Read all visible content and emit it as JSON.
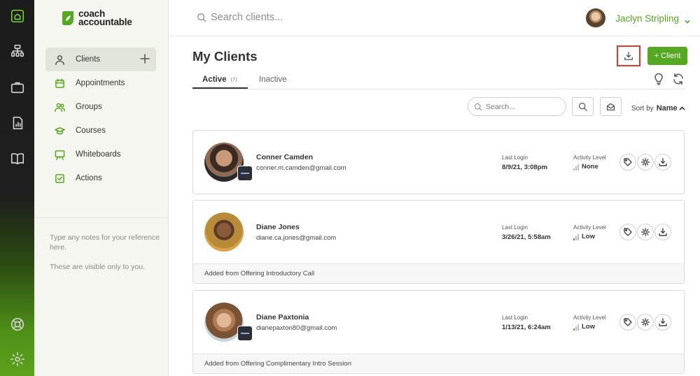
{
  "brand": {
    "line1": "coach",
    "line2": "accountable",
    "color": "#55a821"
  },
  "rail": {
    "icons": [
      "home-icon",
      "org-chart-icon",
      "briefcase-icon",
      "report-icon",
      "book-icon",
      "support-icon",
      "settings-icon"
    ]
  },
  "sidebar": {
    "items": [
      {
        "label": "Clients",
        "icon": "person-icon"
      },
      {
        "label": "Appointments",
        "icon": "calendar-icon"
      },
      {
        "label": "Groups",
        "icon": "group-icon"
      },
      {
        "label": "Courses",
        "icon": "graduation-cap-icon"
      },
      {
        "label": "Whiteboards",
        "icon": "whiteboard-icon"
      },
      {
        "label": "Actions",
        "icon": "checkbox-icon"
      }
    ],
    "notes": [
      "Type any notes for your reference here.",
      "These are visible only to you."
    ]
  },
  "topbar": {
    "search_placeholder": "Search clients...",
    "user_name": "Jaclyn Stripling"
  },
  "main": {
    "title": "My Clients",
    "add_client_label": "+ Client",
    "tabs": [
      {
        "label": "Active",
        "count": "(7)"
      },
      {
        "label": "Inactive"
      }
    ],
    "list_search_placeholder": "Search...",
    "sort_label": "Sort by",
    "sort_value": "Name"
  },
  "clients": [
    {
      "name": "Conner Camden",
      "email": "conner.m.camden@gmail.com",
      "last_login_label": "Last Login",
      "last_login": "8/9/21, 3:08pm",
      "activity_label": "Activity Level",
      "activity": "None",
      "footer": ""
    },
    {
      "name": "Diane Jones",
      "email": "diane.ca.jones@gmail.com",
      "last_login_label": "Last Login",
      "last_login": "3/26/21, 5:58am",
      "activity_label": "Activity Level",
      "activity": "Low",
      "footer": "Added from Offering Introductory Call"
    },
    {
      "name": "Diane Paxtonia",
      "email": "dianepaxton80@gmail.com",
      "last_login_label": "Last Login",
      "last_login": "1/13/21, 6:24am",
      "activity_label": "Activity Level",
      "activity": "Low",
      "footer": "Added from Offering Complimentary Intro Session"
    }
  ]
}
